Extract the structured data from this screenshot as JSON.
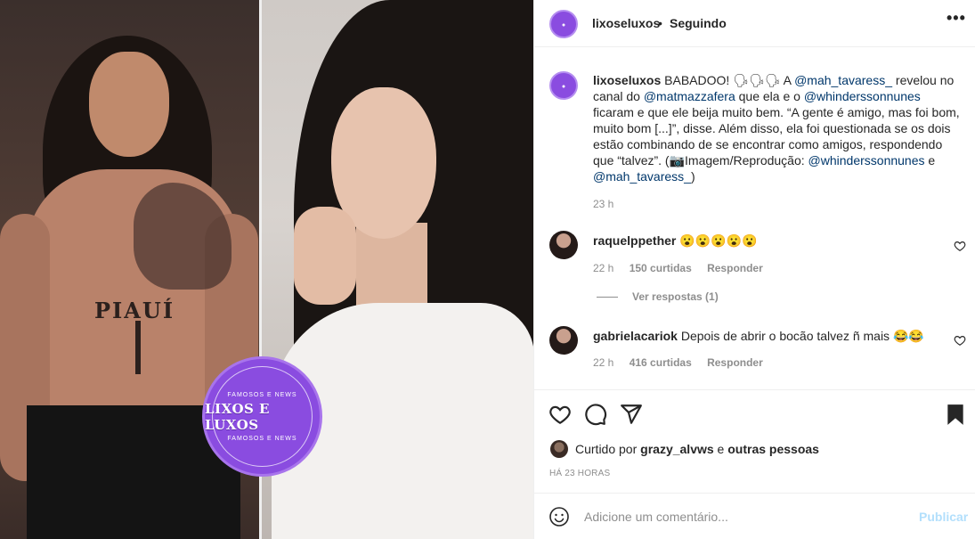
{
  "media": {
    "left_tattoo_text": "PIAUÍ",
    "logo": {
      "main": "LIXOS E LUXOS",
      "sub_top": "FAMOSOS E NEWS",
      "sub_bottom": "FAMOSOS E NEWS"
    }
  },
  "header": {
    "username": "lixoseluxos",
    "separator": "•",
    "follow_status": "Seguindo",
    "more_icon": "more-horizontal-icon"
  },
  "caption": {
    "username": "lixoseluxos",
    "t1": " BABADOO! 🗣🗣🗣 A ",
    "m1": "@mah_tavaress_",
    "t2": " revelou no canal do ",
    "m2": "@matmazzafera",
    "t3": " que ela e o ",
    "m3": "@whinderssonnunes",
    "t4": " ficaram e que ele beija muito bem. “A gente é amigo, mas foi bom, muito bom [...]”, disse. Além disso, ela foi questionada se os dois estão combinando de se encontrar como amigos, respondendo que “talvez”. (📷Imagem/Reprodução: ",
    "m4": "@whinderssonnunes",
    "t5": " e ",
    "m5": "@mah_tavaress_",
    "t6": ")",
    "time": "23 h"
  },
  "comments": [
    {
      "username": "raquelppether",
      "text": "😮😮😮😮😮",
      "time": "22 h",
      "likes": "150 curtidas",
      "reply": "Responder"
    },
    {
      "username": "gabrielacariok",
      "text": "Depois de abrir o bocão talvez ñ mais 😂😂",
      "time": "22 h",
      "likes": "416 curtidas",
      "reply": "Responder"
    }
  ],
  "view_replies": "Ver respostas (1)",
  "actions": {
    "icons": [
      "heart-icon",
      "comment-icon",
      "share-icon",
      "bookmark-icon"
    ]
  },
  "likes": {
    "prefix": "Curtido por ",
    "user": "grazy_alvws",
    "mid": " e ",
    "others": "outras pessoas"
  },
  "posted_ago": "HÁ 23 HORAS",
  "add_comment": {
    "placeholder": "Adicione um comentário...",
    "publish": "Publicar"
  },
  "colors": {
    "accent": "#8a4ce0",
    "link": "#00376b",
    "publish_disabled": "#b2dffc"
  }
}
